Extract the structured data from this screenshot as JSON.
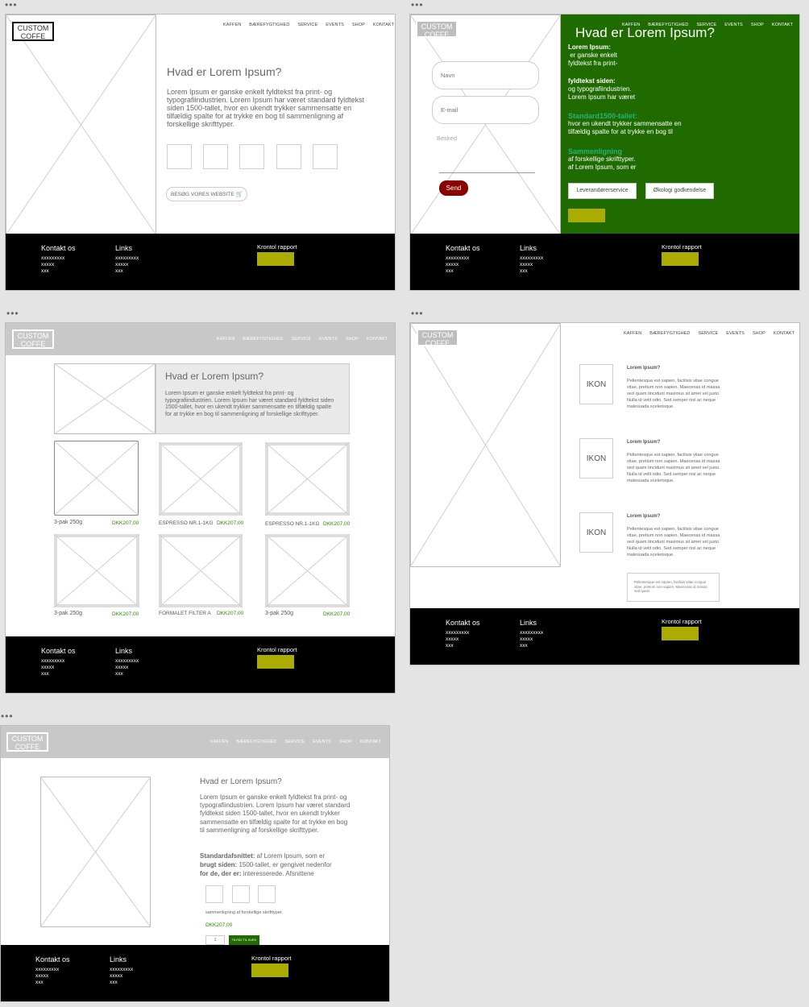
{
  "wf1": {
    "logo": [
      "CUSTOM",
      "COFFE"
    ],
    "nav": [
      "KAFFEN",
      "BÆREFYGTIGHED",
      "SERVICE",
      "EVENTS",
      "SHOP",
      "KONTAKT"
    ],
    "title": "Hvad er Lorem Ipsum?",
    "body": "Lorem Ipsum er ganske enkelt fyldtekst fra print- og typografiindustrien. Lorem Ipsum har været standard fyldtekst siden 1500-tallet, hvor en ukendt trykker sammensatte en tilfældig spalte for at trykke en bog til sammenligning af forskellige skrifttyper.",
    "cta": "BESØG VORES WEBSITE",
    "cart_icon": "cart-icon"
  },
  "wf2": {
    "logo": [
      "CUSTOM",
      "COFFE"
    ],
    "nav": [
      "KAFFEN",
      "BÆREFYGTIGHED",
      "SERVICE",
      "EVENTS",
      "SHOP",
      "KONTAKT"
    ],
    "name_placeholder": "Navn",
    "email_placeholder": "E-mail",
    "message_placeholder": "Besked",
    "send": "Send",
    "title": "Hvad er Lorem Ipsum?",
    "blocks": [
      {
        "head": "Lorem Ipsum:",
        "lines": [
          " er ganske enkelt",
          "fyldtekst fra print-"
        ]
      },
      {
        "head": "fyldtekst siden:",
        "lines": [
          "og typografiindustrien.",
          "Lorem Ipsum har været"
        ]
      },
      {
        "head": "Standard1500-tallet:",
        "lines": [
          "hvor en ukendt trykker sammensatte en",
          "tilfældig spalte for at trykke en bog til"
        ]
      },
      {
        "head": "Sammenligning",
        "lines": [
          "af forskellige skrifttyper.",
          "af Lorem Ipsum, som er"
        ]
      }
    ],
    "btn_supplier": "Leverandørerservice",
    "btn_eco": "Økologi godkendelse",
    "accent": "#1f6b00",
    "teal": "#22b37a"
  },
  "wf3": {
    "logo": [
      "CUSTOM",
      "COFFE"
    ],
    "nav": [
      "KAFFEN",
      "BÆREFYGTIGHED",
      "SERVICE",
      "EVENTS",
      "SHOP",
      "KONTAKT"
    ],
    "title": "Hvad er Lorem Ipsum?",
    "body": "Lorem Ipsum er ganske enkelt fyldtekst fra print- og typografiindustrien. Lorem Ipsum har været standard fyldtekst siden 1500-tallet, hvor en ukendt trykker sammensatte en tilfældig spalte for at trykke en bog til sammenligning af forskellige skrifttyper.",
    "products": [
      {
        "name": "3-pak 250g",
        "price": "DKK207,00"
      },
      {
        "name": "ESPRESSO NR.1-1KG",
        "price": "DKK207,00"
      },
      {
        "name": "ESPRESSO NR.1-1KG",
        "price": "DKK207,00"
      },
      {
        "name": "3-pak 250g",
        "price": "DKK207,00"
      },
      {
        "name": "FORMALET FILTER A",
        "price": "DKK207,00"
      },
      {
        "name": "3-pak 250g",
        "price": "DKK207,00"
      }
    ]
  },
  "wf4": {
    "logo": [
      "CUSTOM",
      "COFFE"
    ],
    "nav": [
      "KAFFEN",
      "BÆREFYGTIGHED",
      "SERVICE",
      "EVENTS",
      "SHOP",
      "KONTAKT"
    ],
    "features": [
      {
        "icon": "IKON",
        "title": "Lorem Ipsum?",
        "text": "Pellentesque est sapien, facilisis vitae congue vitae, pretium non sapien. Maecenas id massa sed quam tincidunt maximus sit amet vel justo. Nulla id velit odio. Sed semper nisl ac neque malesuada scelerisque."
      },
      {
        "icon": "IKON",
        "title": "Lorem Ipsum?",
        "text": "Pellentesque est sapien, facilisis vitae congue vitae, pretium non sapien. Maecenas id massa sed quam tincidunt maximus sit amet vel justo. Nulla id velit odio. Sed semper nisl ac neque malesuada scelerisque."
      },
      {
        "icon": "IKON",
        "title": "Lorem Ipsum?",
        "text": "Pellentesque est sapien, facilisis vitae congue vitae, pretium non sapien. Maecenas id massa sed quam tincidunt maximus sit amet vel justo. Nulla id velit odio. Sed semper nisl ac neque malesuada scelerisque."
      }
    ],
    "box_text": "Pellentesque est sapien, facilisis vitae congue vitae, pretium non sapien. Maecenas id massa sed quam"
  },
  "wf5": {
    "logo": [
      "CUSTOM",
      "COFFE"
    ],
    "nav": [
      "KAFFEN",
      "BÆREFYGTIGHED",
      "SERVICE",
      "EVENTS",
      "SHOP",
      "KONTAKT"
    ],
    "title": "Hvad er Lorem Ipsum?",
    "body": "Lorem Ipsum er ganske enkelt fyldtekst fra print- og typografiindustrien. Lorem Ipsum har været standard fyldtekst siden 1500-tallet, hvor en ukendt trykker sammensatte en tilfældig spalte for at trykke en bog til sammenligning af forskellige skrifttyper.",
    "specs": [
      {
        "k": "Standardafsnittet:",
        "v": " af Lorem Ipsum, som er"
      },
      {
        "k": "brugt siden:",
        "v": " 1500-tallet, er gengivet nedenfor"
      },
      {
        "k": "for de, der er:",
        "v": " interesserede. Afsnittene"
      }
    ],
    "small": "sammenligning af forskellige skrifttyper.",
    "price": "DKK207,00",
    "qty": "1",
    "add_btn": "TILFØJ TIL KURV"
  },
  "footer": {
    "contact": "Kontakt os",
    "contact_lines": [
      "xxxxxxxxx",
      "xxxxx",
      "xxx"
    ],
    "links": "Links",
    "links_lines": [
      "xxxxxxxxx",
      "xxxxx",
      "xxx"
    ],
    "report": "Krontol rapport"
  },
  "colors": {
    "footer_button": "#aaad00",
    "send_button": "#8a0000",
    "price": "#2a8a00"
  }
}
